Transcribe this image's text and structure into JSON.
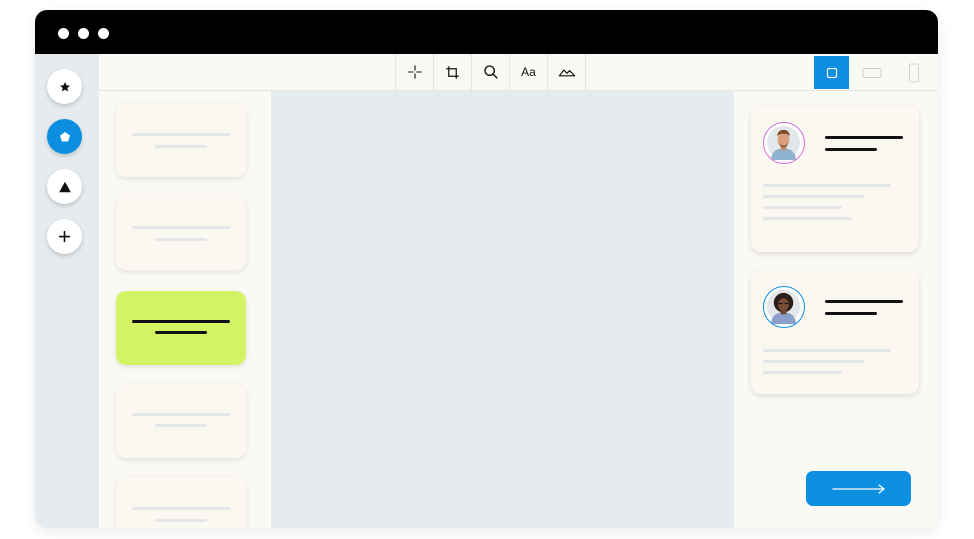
{
  "window": {
    "traffic_dots": [
      "dot",
      "dot",
      "dot"
    ]
  },
  "rail": {
    "items": [
      {
        "name": "star",
        "icon": "star-icon",
        "active": false
      },
      {
        "name": "pentagon",
        "icon": "pentagon-icon",
        "active": true
      },
      {
        "name": "triangle",
        "icon": "triangle-icon",
        "active": false
      },
      {
        "name": "add",
        "icon": "plus-icon",
        "active": false
      }
    ]
  },
  "toolbar": {
    "tools": [
      {
        "name": "move",
        "icon": "move-crosshair-icon"
      },
      {
        "name": "crop",
        "icon": "crop-icon"
      },
      {
        "name": "zoom",
        "icon": "search-icon"
      },
      {
        "name": "text",
        "icon": "text-icon",
        "label": "Aa"
      },
      {
        "name": "image",
        "icon": "landscape-icon"
      }
    ],
    "devices": [
      {
        "name": "square",
        "icon": "square-icon",
        "active": true
      },
      {
        "name": "landscape",
        "icon": "landscape-rect-icon",
        "active": false
      },
      {
        "name": "portrait",
        "icon": "portrait-rect-icon",
        "active": false
      }
    ]
  },
  "slides": {
    "count": 5,
    "selected_index": 2
  },
  "profiles": [
    {
      "name": "profile-card-man",
      "avatar_icon": "man-avatar-icon",
      "ring_color": "#d86fd9"
    },
    {
      "name": "profile-card-woman",
      "avatar_icon": "woman-avatar-icon",
      "ring_color": "#0c8fe0"
    }
  ],
  "cta": {
    "icon": "arrow-right-icon",
    "color": "#0c8fe0"
  },
  "colors": {
    "accent": "#0c8fe0",
    "selected_slide": "#d3f264",
    "canvas": "#e5ebee",
    "titlebar": "#000000"
  }
}
